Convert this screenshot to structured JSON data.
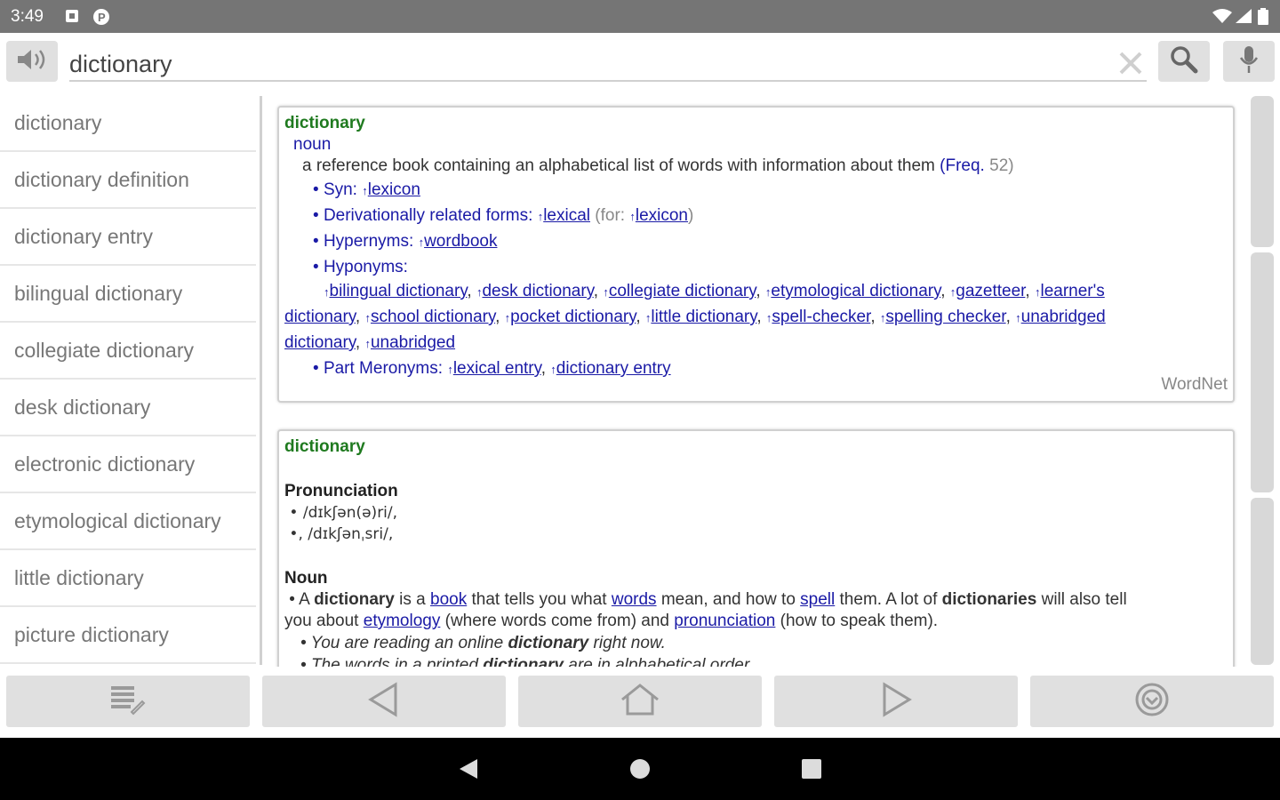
{
  "status_bar": {
    "time": "3:49"
  },
  "search": {
    "value": "dictionary"
  },
  "sidebar": {
    "items": [
      {
        "label": "dictionary"
      },
      {
        "label": "dictionary definition"
      },
      {
        "label": "dictionary entry"
      },
      {
        "label": "bilingual dictionary"
      },
      {
        "label": "collegiate dictionary"
      },
      {
        "label": "desk dictionary"
      },
      {
        "label": "electronic dictionary"
      },
      {
        "label": "etymological dictionary"
      },
      {
        "label": "little dictionary"
      },
      {
        "label": "picture dictionary"
      }
    ]
  },
  "wordnet": {
    "headword": "dictionary",
    "pos": "noun",
    "definition": "a reference book containing an alphabetical list of words with information about them",
    "freq_label": "Freq.",
    "freq_value": "52",
    "syn_label": "Syn:",
    "syn_link": "lexicon",
    "deriv_label": "Derivationally related forms:",
    "deriv_link": "lexical",
    "deriv_for": "(for:",
    "deriv_for_link": "lexicon",
    "deriv_close": ")",
    "hypernyms_label": "Hypernyms:",
    "hypernyms_link": "wordbook",
    "hyponyms_label": "Hyponyms:",
    "hyponyms": [
      "bilingual dictionary",
      "desk dictionary",
      "collegiate dictionary",
      "etymological dictionary",
      "gazetteer",
      "learner's",
      "dictionary",
      "school dictionary",
      "pocket dictionary",
      "little dictionary",
      "spell-checker",
      "spelling checker",
      "unabridged",
      "dictionary",
      "unabridged"
    ],
    "meronyms_label": "Part Meronyms:",
    "meronyms": [
      "lexical entry",
      "dictionary entry"
    ],
    "source": "WordNet"
  },
  "wiki": {
    "headword": "dictionary",
    "pron_heading": "Pronunciation",
    "pron1": "/dɪkʃən(ə)ri/,",
    "pron2": ", /dɪkʃənˌsri/,",
    "noun_heading": "Noun",
    "def_1": "A ",
    "def_b1": "dictionary",
    "def_2": " is a ",
    "def_l1": "book",
    "def_3": " that tells you what ",
    "def_l2": "words",
    "def_4": " mean, and how to ",
    "def_l3": "spell",
    "def_5": " them. A lot of ",
    "def_b2": "dictionaries",
    "def_6": " will also tell",
    "def_7": "you about ",
    "def_l4": "etymology",
    "def_8": " (where words come from) and ",
    "def_l5": "pronunciation",
    "def_9": " (how to speak them).",
    "ex1_a": "You are reading an online ",
    "ex1_b": "dictionary",
    "ex1_c": " right now.",
    "ex2_a": "The words in a printed ",
    "ex2_b": "dictionary",
    "ex2_c": " are in alphabetical order."
  },
  "icons": {
    "speaker": "speaker-icon",
    "clear": "clear-icon",
    "search": "search-icon",
    "mic": "microphone-icon",
    "list": "list-icon",
    "back": "back-arrow-icon",
    "home": "home-icon",
    "forward": "forward-arrow-icon",
    "settings": "settings-icon"
  },
  "colors": {
    "headword": "#1f7a1f",
    "link": "#1a1aa6",
    "status_bar": "#757575",
    "button": "#e0e0e0"
  }
}
